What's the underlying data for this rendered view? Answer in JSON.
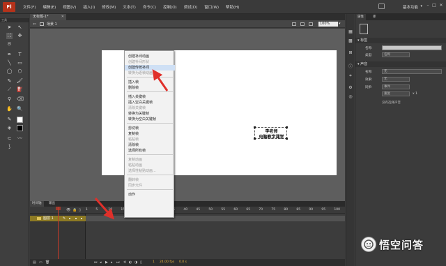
{
  "menubar": {
    "logo": "Fl",
    "items": [
      "文件(F)",
      "编辑(E)",
      "视图(V)",
      "插入(I)",
      "修改(M)",
      "文本(T)",
      "命令(C)",
      "控制(O)",
      "调试(D)",
      "窗口(W)",
      "帮助(H)"
    ],
    "workspace": "基本功能"
  },
  "document": {
    "tab_name": "无标题-1*",
    "scene_label": "场景 1",
    "zoom": "100%"
  },
  "toolbox": {
    "header": "工具"
  },
  "stage": {
    "text_line1": "李老师",
    "text_line2": "电脑教学课堂"
  },
  "context_menu": {
    "items": [
      {
        "label": "创建补间动画",
        "disabled": false
      },
      {
        "label": "创建补间形状",
        "disabled": true
      },
      {
        "label": "创建传统补间",
        "disabled": false,
        "highlight": true
      },
      {
        "label": "转换为逐帧动画",
        "disabled": true
      },
      {
        "label": "插入帧",
        "disabled": false
      },
      {
        "label": "删除帧",
        "disabled": false
      },
      {
        "label": "插入关键帧",
        "disabled": false
      },
      {
        "label": "插入空白关键帧",
        "disabled": false
      },
      {
        "label": "清除关键帧",
        "disabled": true
      },
      {
        "label": "转换为关键帧",
        "disabled": false
      },
      {
        "label": "转换为空白关键帧",
        "disabled": false
      },
      {
        "label": "剪切帧",
        "disabled": false
      },
      {
        "label": "复制帧",
        "disabled": false
      },
      {
        "label": "粘贴帧",
        "disabled": true
      },
      {
        "label": "清除帧",
        "disabled": false
      },
      {
        "label": "选择所有帧",
        "disabled": false
      },
      {
        "label": "复制动画",
        "disabled": true
      },
      {
        "label": "粘贴动画",
        "disabled": true
      },
      {
        "label": "选择性粘贴动画...",
        "disabled": true
      },
      {
        "label": "翻转帧",
        "disabled": true
      },
      {
        "label": "同步元件",
        "disabled": true
      },
      {
        "label": "动作",
        "disabled": false
      }
    ]
  },
  "timeline": {
    "tabs": [
      "时间轴",
      "输出"
    ],
    "layer_name": "图层 1",
    "ruler": [
      "1",
      "5",
      "10",
      "15",
      "20",
      "25",
      "30",
      "35",
      "40",
      "45",
      "50",
      "55",
      "60",
      "65",
      "70",
      "75",
      "80",
      "85",
      "90",
      "95",
      "100"
    ],
    "status_frame": "1",
    "status_fps": "24.00 fps",
    "status_time": "0.0 s"
  },
  "properties": {
    "tabs": [
      "属性",
      "库"
    ],
    "label_section": "标签",
    "name_label": "名称:",
    "type_label": "类型:",
    "type_value": "名称",
    "sound_section": "声音",
    "sound_name_label": "名称:",
    "sound_name_value": "无",
    "effect_label": "效果:",
    "effect_value": "无",
    "sync_label": "同步:",
    "sync_value": "事件",
    "repeat_value": "重复",
    "repeat_count": "x 1",
    "no_sound": "没有选择声音"
  },
  "watermark": {
    "text": "悟空问答"
  },
  "colors": {
    "layer_highlight": "#8d7a24",
    "playhead": "#c63a2a",
    "annotation_arrow": "#e0302a",
    "menu_highlight": "#cfe0f5"
  }
}
